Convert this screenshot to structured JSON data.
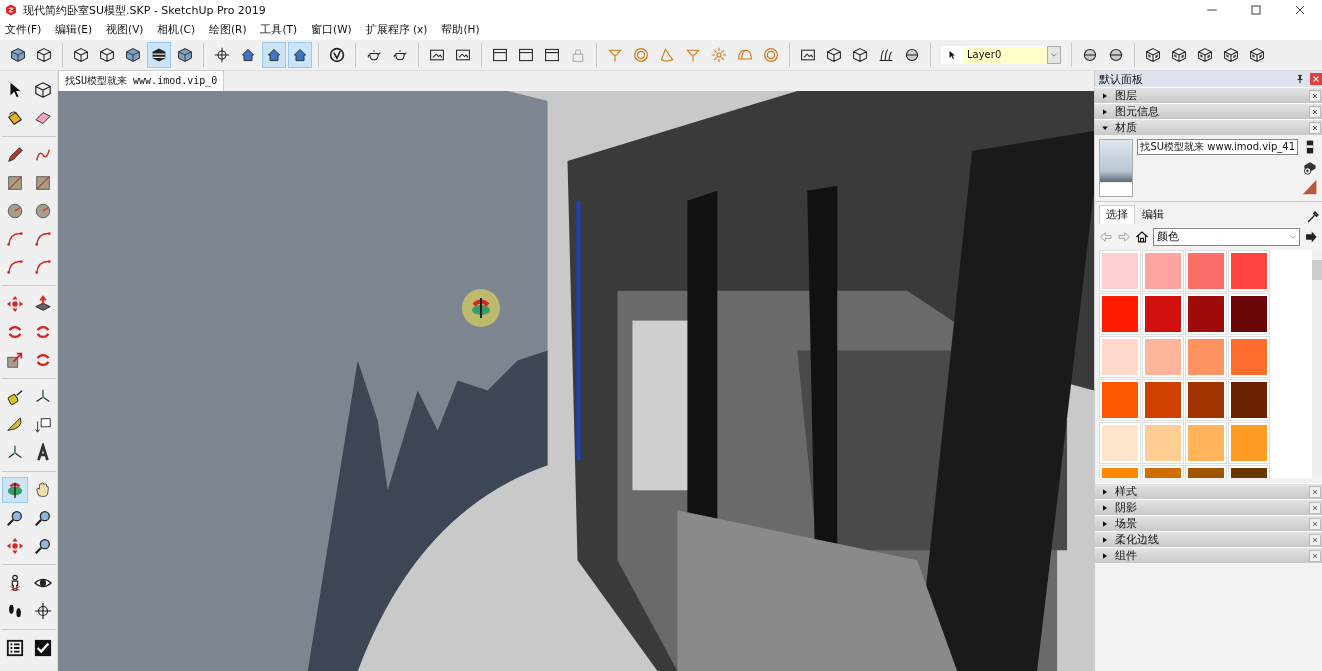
{
  "window": {
    "title": "现代简约卧室SU模型.SKP - SketchUp Pro 2019"
  },
  "menu": [
    "文件(F)",
    "编辑(E)",
    "视图(V)",
    "相机(C)",
    "绘图(R)",
    "工具(T)",
    "窗口(W)",
    "扩展程序 (x)",
    "帮助(H)"
  ],
  "toolbar": [
    {
      "kind": "cube",
      "selected": false
    },
    {
      "kind": "cube-outline",
      "selected": false
    },
    {
      "kind": "sep"
    },
    {
      "kind": "cube-outline",
      "selected": false
    },
    {
      "kind": "cube-outline",
      "selected": false
    },
    {
      "kind": "cube",
      "selected": false
    },
    {
      "kind": "stripe",
      "selected": true
    },
    {
      "kind": "cube",
      "selected": false
    },
    {
      "kind": "sep"
    },
    {
      "kind": "crosshair",
      "selected": false
    },
    {
      "kind": "house",
      "selected": false
    },
    {
      "kind": "house",
      "selected": true
    },
    {
      "kind": "house",
      "selected": true
    },
    {
      "kind": "sep"
    },
    {
      "kind": "vcircle",
      "selected": false
    },
    {
      "kind": "sep"
    },
    {
      "kind": "teapot",
      "selected": false
    },
    {
      "kind": "teapot",
      "selected": false
    },
    {
      "kind": "sep"
    },
    {
      "kind": "frame",
      "selected": false
    },
    {
      "kind": "frame",
      "selected": false
    },
    {
      "kind": "sep"
    },
    {
      "kind": "window",
      "selected": false
    },
    {
      "kind": "window",
      "selected": false
    },
    {
      "kind": "window",
      "selected": false
    },
    {
      "kind": "lock",
      "selected": false
    },
    {
      "kind": "sep"
    },
    {
      "kind": "lamp",
      "selected": false
    },
    {
      "kind": "ring",
      "selected": false
    },
    {
      "kind": "cone",
      "selected": false
    },
    {
      "kind": "lamp",
      "selected": false
    },
    {
      "kind": "sun",
      "selected": false
    },
    {
      "kind": "dome",
      "selected": false
    },
    {
      "kind": "ring",
      "selected": false
    },
    {
      "kind": "sep"
    },
    {
      "kind": "frame",
      "selected": false
    },
    {
      "kind": "cube-outline",
      "selected": false
    },
    {
      "kind": "cube-outline",
      "selected": false
    },
    {
      "kind": "grass",
      "selected": false
    },
    {
      "kind": "sphere",
      "selected": false
    }
  ],
  "layer": {
    "value": "Layer0"
  },
  "toolbar_right": [
    {
      "kind": "sphere",
      "selected": false
    },
    {
      "kind": "sphere",
      "selected": false
    },
    {
      "kind": "sep"
    },
    {
      "kind": "checker",
      "selected": false
    },
    {
      "kind": "checker",
      "selected": false
    },
    {
      "kind": "checker",
      "selected": false
    },
    {
      "kind": "checker",
      "selected": false
    },
    {
      "kind": "checker",
      "selected": false
    }
  ],
  "scene_tab": {
    "label": "找SU模型就来 www.imod.vip_0",
    "selected": true
  },
  "tools": [
    {
      "kind": "arrow",
      "selected": false
    },
    {
      "kind": "cube-outline",
      "selected": false
    },
    {
      "kind": "bucket",
      "selected": false
    },
    {
      "kind": "eraser",
      "selected": false
    },
    {
      "kind": "sep"
    },
    {
      "kind": "pencil",
      "selected": false
    },
    {
      "kind": "curve",
      "selected": false
    },
    {
      "kind": "rect",
      "selected": false
    },
    {
      "kind": "rect",
      "selected": false
    },
    {
      "kind": "circle",
      "selected": false
    },
    {
      "kind": "circle",
      "selected": false
    },
    {
      "kind": "arc",
      "selected": false
    },
    {
      "kind": "arc",
      "selected": false
    },
    {
      "kind": "arc",
      "selected": false
    },
    {
      "kind": "arc",
      "selected": false
    },
    {
      "kind": "sep"
    },
    {
      "kind": "move",
      "selected": false
    },
    {
      "kind": "pushpull",
      "selected": false
    },
    {
      "kind": "rotate",
      "selected": false
    },
    {
      "kind": "rotate",
      "selected": false
    },
    {
      "kind": "scale",
      "selected": false
    },
    {
      "kind": "rotate",
      "selected": false
    },
    {
      "kind": "sep"
    },
    {
      "kind": "tape",
      "selected": false
    },
    {
      "kind": "axes",
      "selected": false
    },
    {
      "kind": "protractor",
      "selected": false
    },
    {
      "kind": "text",
      "selected": false
    },
    {
      "kind": "axes",
      "selected": false
    },
    {
      "kind": "letter",
      "selected": false
    },
    {
      "kind": "sep"
    },
    {
      "kind": "orbit",
      "selected": true
    },
    {
      "kind": "hand",
      "selected": false
    },
    {
      "kind": "zoom",
      "selected": false
    },
    {
      "kind": "zoom",
      "selected": false
    },
    {
      "kind": "move",
      "selected": false
    },
    {
      "kind": "zoom",
      "selected": false
    },
    {
      "kind": "sep"
    },
    {
      "kind": "person",
      "selected": false
    },
    {
      "kind": "eye",
      "selected": false
    },
    {
      "kind": "feet",
      "selected": false
    },
    {
      "kind": "crosshair",
      "selected": false
    },
    {
      "kind": "sep"
    },
    {
      "kind": "list",
      "selected": false
    },
    {
      "kind": "check",
      "selected": false
    }
  ],
  "tray": {
    "title": "默认面板",
    "sections_top": [
      {
        "label": "图层",
        "expanded": false
      },
      {
        "label": "图元信息",
        "expanded": false
      },
      {
        "label": "材质",
        "expanded": true
      }
    ],
    "material": {
      "name": "找SU模型就来 www.imod.vip_41"
    },
    "tabs": [
      {
        "label": "选择",
        "selected": true
      },
      {
        "label": "编辑",
        "selected": false
      }
    ],
    "library": {
      "value": "颜色"
    },
    "swatches": [
      {
        "color": "#fdcfcf"
      },
      {
        "color": "#fda3a0"
      },
      {
        "color": "#fd6e69"
      },
      {
        "color": "#fd443c"
      },
      {
        "color": "#ff1a00"
      },
      {
        "color": "#d10f0f"
      },
      {
        "color": "#9e0b0b"
      },
      {
        "color": "#6b0606"
      },
      {
        "color": "#ffd8cc"
      },
      {
        "color": "#ffb59a"
      },
      {
        "color": "#ff9361"
      },
      {
        "color": "#ff6d2e"
      },
      {
        "color": "#ff5500"
      },
      {
        "color": "#d04000"
      },
      {
        "color": "#a03300"
      },
      {
        "color": "#6b2200"
      },
      {
        "color": "#ffe4cc"
      },
      {
        "color": "#ffcc94"
      },
      {
        "color": "#ffb35a"
      },
      {
        "color": "#ff9a22"
      },
      {
        "color": "#ff8800"
      },
      {
        "color": "#d06d00"
      },
      {
        "color": "#a05500"
      },
      {
        "color": "#6b3800"
      }
    ],
    "sections_bottom": [
      {
        "label": "样式",
        "expanded": false
      },
      {
        "label": "阴影",
        "expanded": false
      },
      {
        "label": "场景",
        "expanded": false
      },
      {
        "label": "柔化边线",
        "expanded": false
      },
      {
        "label": "组件",
        "expanded": false
      }
    ]
  }
}
